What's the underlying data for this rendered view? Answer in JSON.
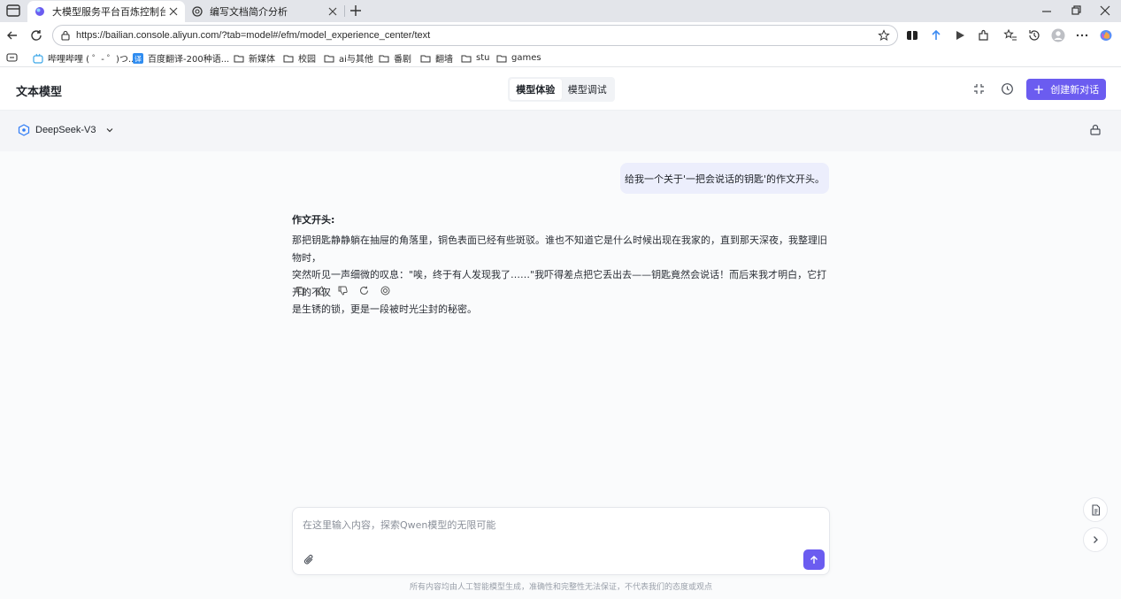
{
  "browser": {
    "tabs": [
      {
        "title": "大模型服务平台百炼控制台",
        "active": true
      },
      {
        "title": "编写文档简介分析",
        "active": false
      }
    ],
    "url": "https://bailian.console.aliyun.com/?tab=model#/efm/model_experience_center/text",
    "bookmarks": [
      {
        "label": "哔哩哔哩 ( ゜- ゜)つ...",
        "icon": "bilibili-icon"
      },
      {
        "label": "百度翻译-200种语...",
        "icon": "baidu-translate-icon"
      },
      {
        "label": "新媒体",
        "icon": "folder-icon"
      },
      {
        "label": "校园",
        "icon": "folder-icon"
      },
      {
        "label": "ai与其他",
        "icon": "folder-icon"
      },
      {
        "label": "番剧",
        "icon": "folder-icon"
      },
      {
        "label": "翻墙",
        "icon": "folder-icon"
      },
      {
        "label": "stu",
        "icon": "folder-icon"
      },
      {
        "label": "games",
        "icon": "folder-icon"
      }
    ]
  },
  "app": {
    "title": "文本模型",
    "modes": [
      {
        "label": "模型体验",
        "active": true
      },
      {
        "label": "模型调试",
        "active": false
      }
    ],
    "new_chat_label": "创建新对话",
    "accent_color": "#6b5cf0",
    "model_name": "DeepSeek-V3"
  },
  "chat": {
    "user_message": "给我一个关于'一把会说话的钥匙'的作文开头。",
    "answer_heading": "作文开头:",
    "answer_lines": [
      "那把钥匙静静躺在抽屉的角落里，铜色表面已经有些斑驳。谁也不知道它是什么时候出现在我家的，直到那天深夜，我整理旧物时，",
      "突然听见一声细微的叹息：\"唉，终于有人发现我了……\"我吓得差点把它丢出去——钥匙竟然会说话！而后来我才明白，它打开的不仅",
      "是生锈的锁，更是一段被时光尘封的秘密。"
    ],
    "answer_actions": [
      "copy-icon",
      "thumbs-up-icon",
      "thumbs-down-icon",
      "regenerate-icon",
      "share-icon"
    ]
  },
  "composer": {
    "placeholder": "在这里输入内容，探索Qwen模型的无限可能",
    "disclaimer": "所有内容均由人工智能模型生成，准确性和完整性无法保证，不代表我们的态度或观点"
  }
}
